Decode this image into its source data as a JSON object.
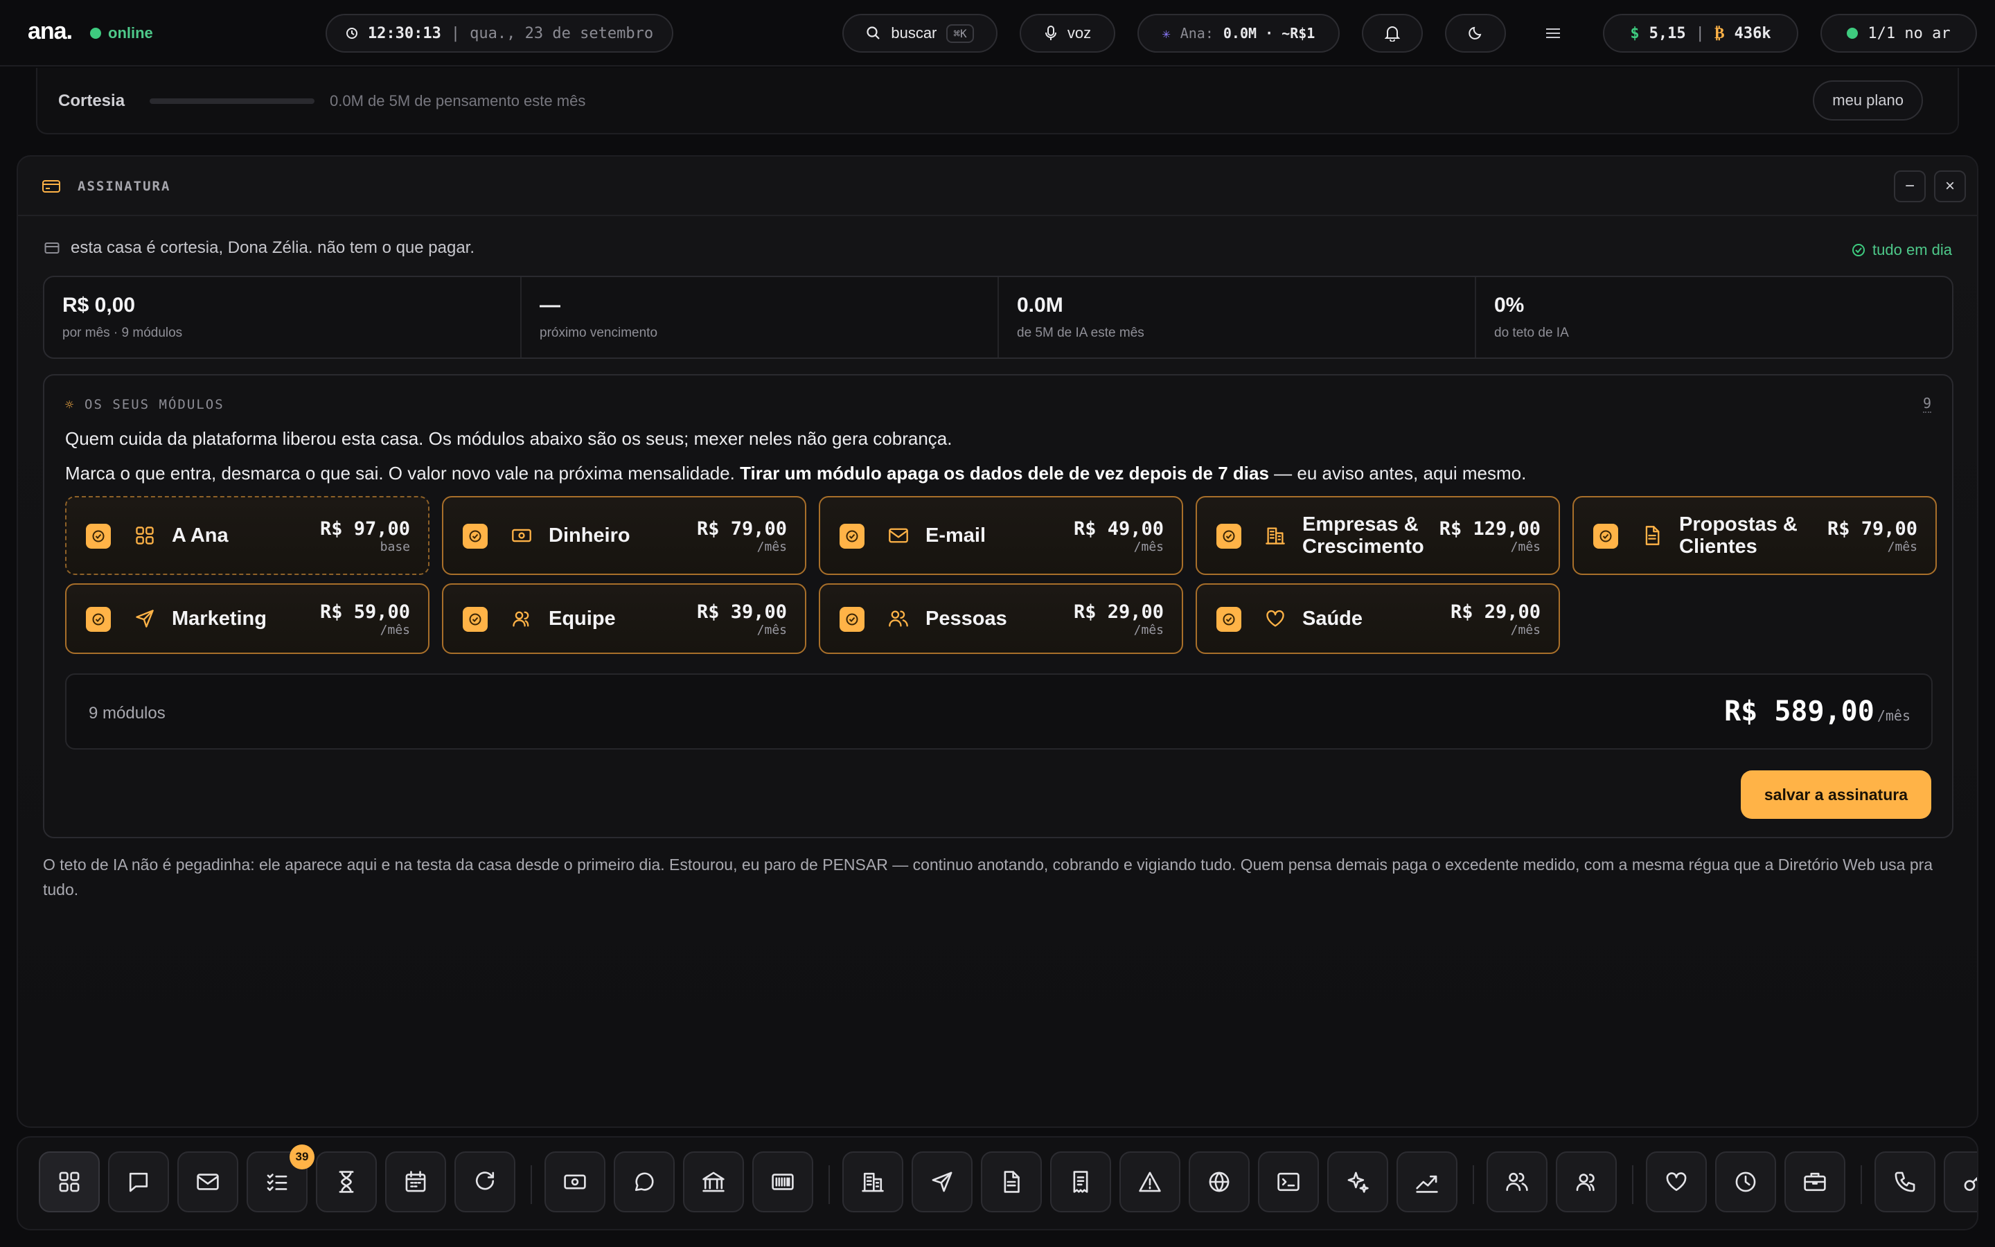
{
  "topbar": {
    "logo": "ana.",
    "status": "online",
    "time": "12:30:13",
    "sep": "|",
    "date": "qua., 23 de setembro",
    "search_label": "buscar",
    "search_kbd": "⌘K",
    "voice_label": "voz",
    "ai_label": "Ana:",
    "ai_value": "0.0M · ~R$1",
    "balance_value": "5,15",
    "balance_sep": "|",
    "btc_value": "436k",
    "live_label": "1/1 no ar"
  },
  "cortesia": {
    "label": "Cortesia",
    "usage_text": "0.0M de 5M de pensamento este mês",
    "usage_fraction": 0.0,
    "plan_button": "meu plano"
  },
  "panel": {
    "title": "ASSINATURA",
    "minimize": "−",
    "close": "×",
    "notice": "esta casa é cortesia, Dona Zélia. não tem o que pagar.",
    "status": "tudo em dia",
    "stats": [
      {
        "value": "R$ 0,00",
        "label": "por mês · 9 módulos"
      },
      {
        "value": "—",
        "label": "próximo vencimento"
      },
      {
        "value": "0.0M",
        "label": "de 5M de IA este mês"
      },
      {
        "value": "0%",
        "label": "do teto de IA"
      }
    ],
    "modules_title": "OS SEUS MÓDULOS",
    "modules_count": "9",
    "intro1": "Quem cuida da plataforma liberou esta casa. Os módulos abaixo são os seus; mexer neles não gera cobrança.",
    "intro2_a": "Marca o que entra, desmarca o que sai. O valor novo vale na próxima mensalidade. ",
    "intro2_b": "Tirar um módulo apaga os dados dele de vez depois de 7 dias",
    "intro2_c": " — eu aviso antes, aqui mesmo.",
    "modules": [
      {
        "name": "A Ana",
        "price": "R$ 97,00",
        "sub": "base",
        "icon": "grid-icon",
        "checked": true
      },
      {
        "name": "Dinheiro",
        "price": "R$ 79,00",
        "sub": "/mês",
        "icon": "cash-icon",
        "checked": true
      },
      {
        "name": "E-mail",
        "price": "R$ 49,00",
        "sub": "/mês",
        "icon": "mail-icon",
        "checked": true
      },
      {
        "name": "Empresas & Crescimento",
        "price": "R$ 129,00",
        "sub": "/mês",
        "icon": "building-icon",
        "checked": true
      },
      {
        "name": "Propostas & Clientes",
        "price": "R$ 79,00",
        "sub": "/mês",
        "icon": "document-icon",
        "checked": true
      },
      {
        "name": "Marketing",
        "price": "R$ 59,00",
        "sub": "/mês",
        "icon": "send-icon",
        "checked": true
      },
      {
        "name": "Equipe",
        "price": "R$ 39,00",
        "sub": "/mês",
        "icon": "team-icon",
        "checked": true
      },
      {
        "name": "Pessoas",
        "price": "R$ 29,00",
        "sub": "/mês",
        "icon": "people-icon",
        "checked": true
      },
      {
        "name": "Saúde",
        "price": "R$ 29,00",
        "sub": "/mês",
        "icon": "heart-icon",
        "checked": true
      }
    ],
    "total_count": "9 módulos",
    "total_value": "R$ 589,00",
    "total_suffix": "/mês",
    "save_button": "salvar a assinatura",
    "footnote": "O teto de IA não é pegadinha: ele aparece aqui e na testa da casa desde o primeiro dia. Estourou, eu paro de PENSAR — continuo anotando, cobrando e vigiando tudo. Quem pensa demais paga o excedente medido, com a mesma régua que a Diretório Web usa pra tudo."
  },
  "dock": {
    "tasks_badge": "39",
    "icons": [
      "apps-icon",
      "chat-icon",
      "mail-icon",
      "tasks-icon",
      "hourglass-icon",
      "calendar-icon",
      "refresh-icon",
      "cash-icon",
      "whatsapp-icon",
      "bank-icon",
      "barcode-icon",
      "building-icon",
      "send-icon",
      "document-icon",
      "receipt-icon",
      "alert-icon",
      "globe-icon",
      "terminal-icon",
      "sparkles-icon",
      "chart-icon",
      "people-icon",
      "team-icon",
      "heart-icon",
      "clock-icon",
      "briefcase-icon",
      "phone-icon",
      "key-icon"
    ]
  },
  "colors": {
    "accent": "#ffb347",
    "success": "#3ecb7f",
    "background": "#0c0c0e"
  }
}
